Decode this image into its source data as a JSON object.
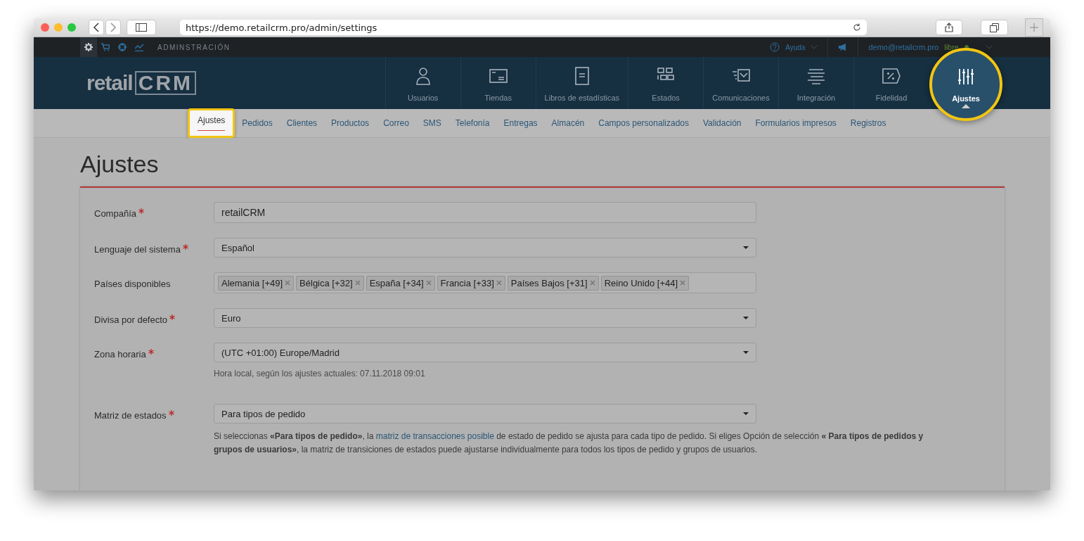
{
  "browser": {
    "url": "https://demo.retailcrm.pro/admin/settings"
  },
  "top_bar": {
    "icons": [
      {
        "selected": true
      },
      {
        "selected": false
      },
      {
        "selected": false
      },
      {
        "selected": false
      }
    ],
    "section": "ADMINSTRACIÓN",
    "help": "Ayuda",
    "user": "demo@retailcrm.pro",
    "plan": "libre"
  },
  "logo": {
    "text": "retail",
    "mark": "CRM"
  },
  "nav": [
    {
      "label": "Usuarios",
      "selected": false
    },
    {
      "label": "Tiendas",
      "selected": false
    },
    {
      "label": "Libros de estadísticas",
      "selected": false
    },
    {
      "label": "Estados",
      "selected": false
    },
    {
      "label": "Comunicaciones",
      "selected": false
    },
    {
      "label": "Integración",
      "selected": false
    },
    {
      "label": "Fidelidad",
      "selected": false
    },
    {
      "label": "Ajustes",
      "selected": true
    }
  ],
  "subnav": [
    {
      "label": "Ajustes",
      "selected": true
    },
    {
      "label": "Pedidos",
      "selected": false
    },
    {
      "label": "Clientes",
      "selected": false
    },
    {
      "label": "Productos",
      "selected": false
    },
    {
      "label": "Correo",
      "selected": false
    },
    {
      "label": "SMS",
      "selected": false
    },
    {
      "label": "Telefonía",
      "selected": false
    },
    {
      "label": "Entregas",
      "selected": false
    },
    {
      "label": "Almacén",
      "selected": false
    },
    {
      "label": "Campos personalizados",
      "selected": false
    },
    {
      "label": "Validación",
      "selected": false
    },
    {
      "label": "Formularios impresos",
      "selected": false
    },
    {
      "label": "Registros",
      "selected": false
    }
  ],
  "page_title": "Ajustes",
  "form": [
    {
      "kind": "text",
      "label": "Compañía",
      "required": true,
      "value": "retailCRM"
    },
    {
      "kind": "select",
      "label": "Lenguaje del sistema",
      "required": true,
      "value": "Español"
    },
    {
      "kind": "tags",
      "label": "Países disponibles",
      "required": false,
      "tags": [
        "Alemania [+49]",
        "Bélgica [+32]",
        "España [+34]",
        "Francia [+33]",
        "Países Bajos [+31]",
        "Reino Unido [+44]"
      ]
    },
    {
      "kind": "select",
      "label": "Divisa por defecto",
      "required": true,
      "value": "Euro"
    },
    {
      "kind": "select",
      "label": "Zona horaria",
      "required": true,
      "value": "(UTC +01:00) Europe/Madrid",
      "hint": "Hora local, según los ajustes actuales: 07.11.2018 09:01"
    },
    {
      "kind": "select",
      "label": "Matriz de estados",
      "required": true,
      "value": "Para tipos de pedido",
      "note": {
        "before": "Si seleccionas **«Para tipos de pedido»**, la",
        "link": "matriz de transacciones posible",
        "after": "de estado de pedido se ajusta para cada tipo de pedido. Si eliges Opción de selección **« Para tipos de pedidos y grupos de usuarios»**, la matriz de transiciones de estados puede ajustarse individualmente para todos los tipos de pedido y grupos de usuarios."
      }
    }
  ]
}
